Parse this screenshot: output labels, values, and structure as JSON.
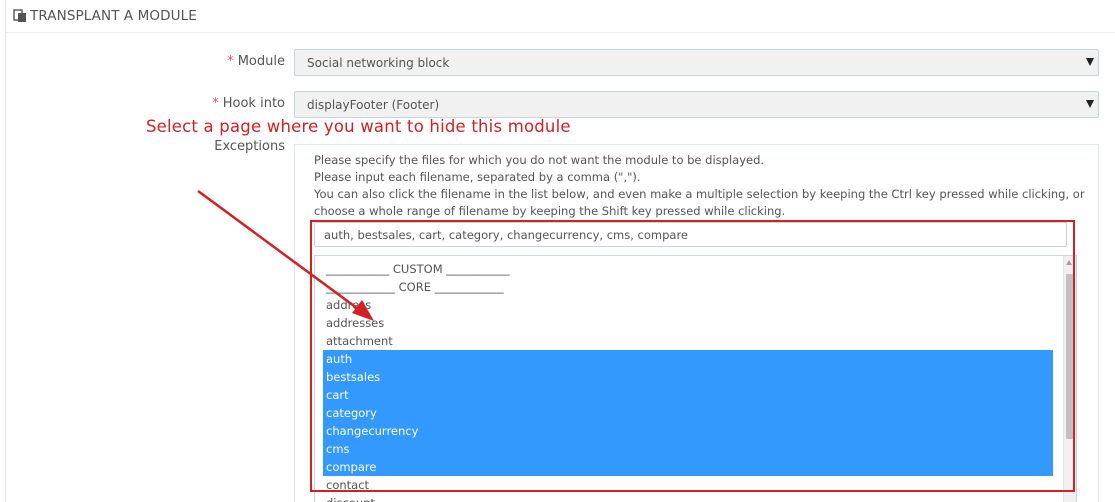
{
  "panel": {
    "title": "TRANSPLANT A MODULE",
    "icon": "transplant-icon"
  },
  "form": {
    "module": {
      "label": "Module",
      "required_mark": "*",
      "value": "Social networking block"
    },
    "hook": {
      "label": "Hook into",
      "required_mark": "*",
      "value": "displayFooter (Footer)"
    },
    "exceptions": {
      "label": "Exceptions",
      "help": [
        "Please specify the files for which you do not want the module to be displayed.",
        "Please input each filename, separated by a comma (\",\").",
        "You can also click the filename in the list below, and even make a multiple selection by keeping the Ctrl key pressed while clicking, or",
        "choose a whole range of filename by keeping the Shift key pressed while clicking."
      ],
      "input_value": "auth, bestsales, cart, category, changecurrency, cms, compare",
      "options": [
        {
          "label": "___________ CUSTOM ___________",
          "selected": false
        },
        {
          "label": "____________ CORE ____________",
          "selected": false
        },
        {
          "label": "address",
          "selected": false
        },
        {
          "label": "addresses",
          "selected": false
        },
        {
          "label": "attachment",
          "selected": false
        },
        {
          "label": "auth",
          "selected": true
        },
        {
          "label": "bestsales",
          "selected": true
        },
        {
          "label": "cart",
          "selected": true
        },
        {
          "label": "category",
          "selected": true
        },
        {
          "label": "changecurrency",
          "selected": true
        },
        {
          "label": "cms",
          "selected": true
        },
        {
          "label": "compare",
          "selected": true
        },
        {
          "label": "contact",
          "selected": false
        },
        {
          "label": "discount",
          "selected": false
        }
      ]
    }
  },
  "annotation": {
    "text": "Select a page where you want to hide this module",
    "color": "#d42020"
  },
  "colors": {
    "selection": "#3399ff",
    "required": "#e05050"
  }
}
